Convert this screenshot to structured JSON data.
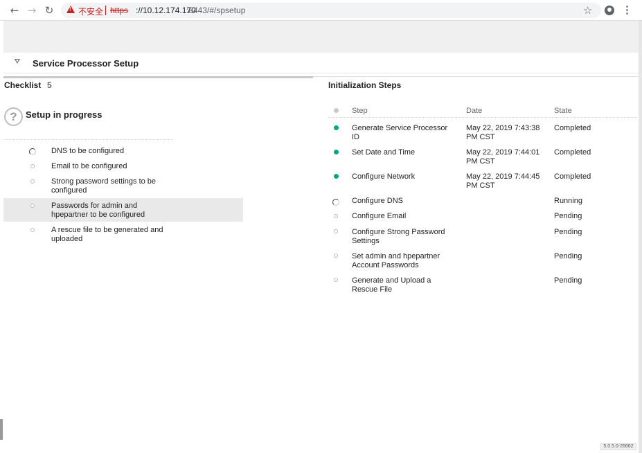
{
  "browser": {
    "back_icon": "←",
    "forward_icon": "→",
    "reload_icon": "↻",
    "security_label": "不安全",
    "url_scheme": "https",
    "url_host": "://10.12.174.170",
    "url_path": ":8443/#/spsetup",
    "star_icon": "☆",
    "menu_icon": "⋮"
  },
  "page": {
    "title": "Service Processor Setup"
  },
  "checklist": {
    "title": "Checklist",
    "count": "5",
    "help_glyph": "?",
    "status_heading": "Setup in progress",
    "items": [
      {
        "label": "DNS to be configured",
        "status": "in-progress"
      },
      {
        "label": "Email to be configured",
        "status": "pending"
      },
      {
        "label": "Strong password settings to be configured",
        "status": "pending"
      },
      {
        "label": "Passwords for admin and hpepartner to be configured",
        "status": "pending"
      },
      {
        "label": "A rescue file to be generated and uploaded",
        "status": "pending"
      }
    ]
  },
  "init": {
    "title": "Initialization Steps",
    "columns": {
      "step": "Step",
      "date": "Date",
      "state": "State"
    },
    "rows": [
      {
        "step": "Generate Service Processor ID",
        "date": "May 22, 2019 7:43:38 PM CST",
        "state": "Completed",
        "status": "done"
      },
      {
        "step": "Set Date and Time",
        "date": "May 22, 2019 7:44:01 PM CST",
        "state": "Completed",
        "status": "done"
      },
      {
        "step": "Configure Network",
        "date": "May 22, 2019 7:44:45 PM CST",
        "state": "Completed",
        "status": "done"
      },
      {
        "step": "Configure DNS",
        "date": "",
        "state": "Running",
        "status": "running"
      },
      {
        "step": "Configure Email",
        "date": "",
        "state": "Pending",
        "status": "pending"
      },
      {
        "step": "Configure Strong Password Settings",
        "date": "",
        "state": "Pending",
        "status": "pending"
      },
      {
        "step": "Set admin and hpepartner Account Passwords",
        "date": "",
        "state": "Pending",
        "status": "pending"
      },
      {
        "step": "Generate and Upload a Rescue File",
        "date": "",
        "state": "Pending",
        "status": "pending"
      }
    ]
  },
  "version": "5.0.5.0-26662",
  "colors": {
    "status_done": "#01a982",
    "insecure": "#c5221f",
    "highlight_row": "#e9e9e9"
  }
}
